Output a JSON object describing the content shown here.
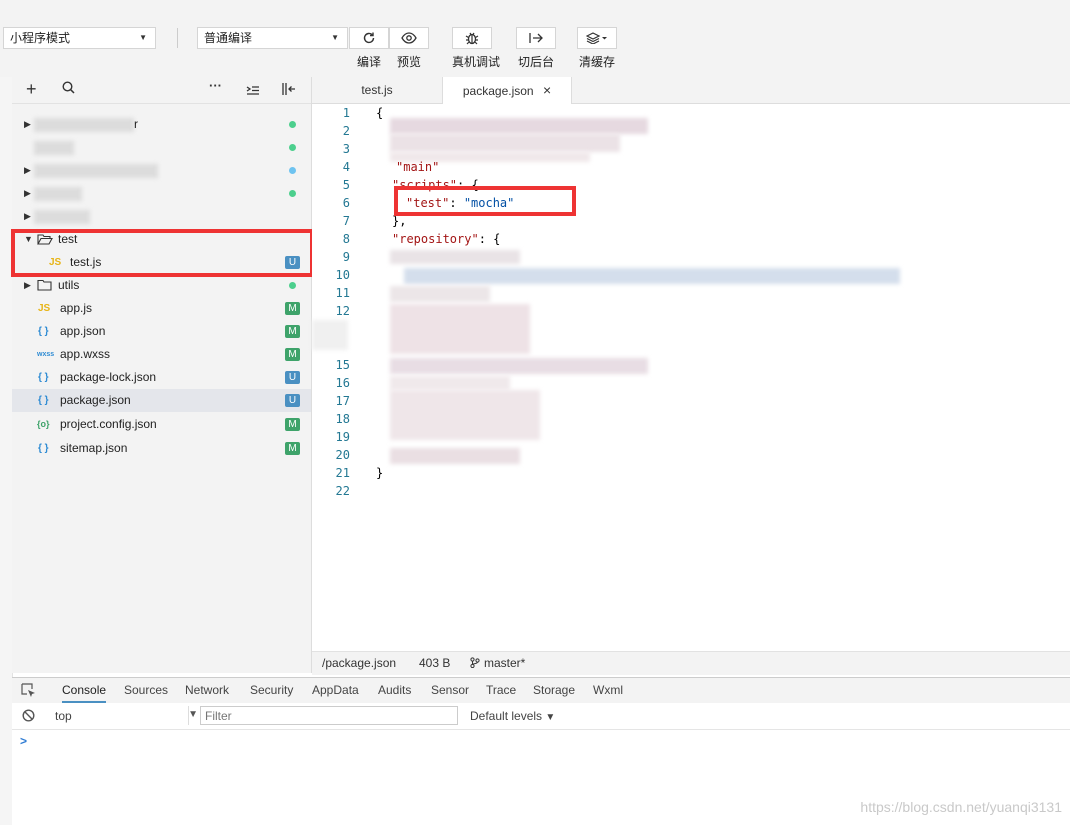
{
  "toolbar": {
    "mode_select": "小程序模式",
    "compile_select": "普通编译",
    "buttons": [
      {
        "icon": "refresh-icon",
        "label": "编译"
      },
      {
        "icon": "eye-icon",
        "label": "预览"
      },
      {
        "icon": "bug-icon",
        "label": "真机调试"
      },
      {
        "icon": "switch-background-icon",
        "label": "切后台"
      },
      {
        "icon": "layers-icon",
        "label": "清缓存"
      }
    ]
  },
  "sidebar": {
    "toolbar_icons": [
      "plus-icon",
      "search-icon",
      "more-icon",
      "collapse-icon",
      "split-icon"
    ],
    "folder_test": "test",
    "file_test_js": {
      "name": "test.js",
      "badge": "U"
    },
    "folder_utils": "utils",
    "files": [
      {
        "name": "app.js",
        "icon": "JS",
        "badge": "M"
      },
      {
        "name": "app.json",
        "icon": "{ }",
        "badge": "M"
      },
      {
        "name": "app.wxss",
        "icon": "wxss",
        "badge": "M"
      },
      {
        "name": "package-lock.json",
        "icon": "{ }",
        "badge": "U"
      },
      {
        "name": "package.json",
        "icon": "{ }",
        "badge": "U"
      },
      {
        "name": "project.config.json",
        "icon": "{o}",
        "badge": "M"
      },
      {
        "name": "sitemap.json",
        "icon": "{ }",
        "badge": "M"
      }
    ],
    "blurred_row1_tail": "r"
  },
  "editor": {
    "tabs": [
      {
        "label": "test.js"
      },
      {
        "label": "package.json",
        "close": "×"
      }
    ],
    "line_numbers": [
      "1",
      "2",
      "3",
      "4",
      "5",
      "6",
      "7",
      "8",
      "9",
      "10",
      "11",
      "12",
      "15",
      "16",
      "17",
      "18",
      "19",
      "20",
      "21",
      "22"
    ],
    "code": {
      "open_brace": "{",
      "main_key": "\"main\"",
      "scripts_key": "\"scripts\"",
      "scripts_open": ": {",
      "test_key": "\"test\"",
      "colon": ": ",
      "test_value": "\"mocha\"",
      "scripts_close": "},",
      "repository_key": "\"repository\"",
      "repository_open": ": {",
      "close_brace": "}"
    }
  },
  "statusbar": {
    "path": "/package.json",
    "size": "403 B",
    "branch": "master*"
  },
  "devtools": {
    "tabs": [
      "Console",
      "Sources",
      "Network",
      "Security",
      "AppData",
      "Audits",
      "Sensor",
      "Trace",
      "Storage",
      "Wxml"
    ],
    "context": "top",
    "filter_placeholder": "Filter",
    "levels": "Default levels",
    "prompt": ">"
  },
  "watermark": "https://blog.csdn.net/yuanqi3131",
  "colors": {
    "badge_M": "#3ea36a",
    "badge_U": "#4a90c2",
    "highlight": "#ee3333",
    "js_icon": "#e7b416",
    "json_icon": "#2e8bd3"
  }
}
